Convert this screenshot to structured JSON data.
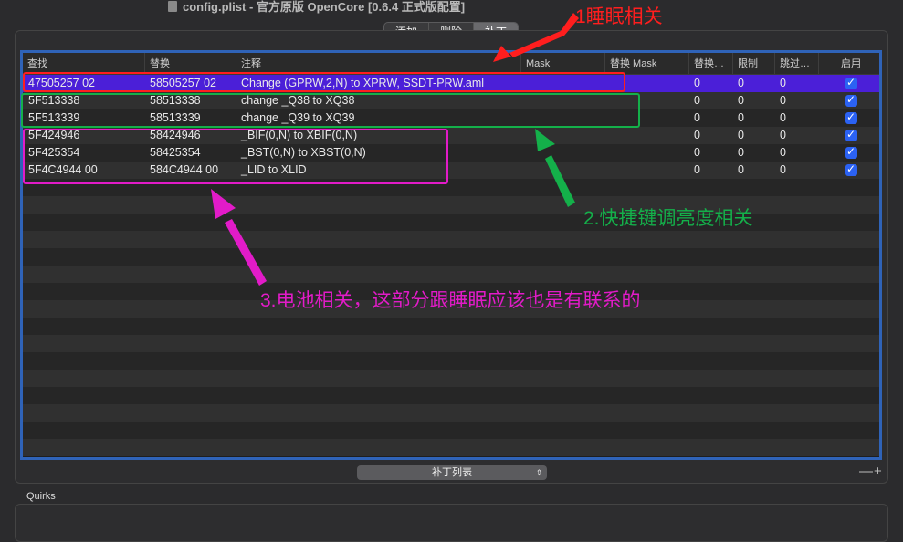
{
  "window": {
    "title": "config.plist - 官方原版 OpenCore [0.6.4 正式版配置]"
  },
  "segmented": {
    "tabs": [
      "添加",
      "删除",
      "补丁"
    ],
    "active": "补丁"
  },
  "table": {
    "headers": [
      "查找",
      "替换",
      "注释",
      "Mask",
      "替换 Mask",
      "替换…",
      "限制",
      "跳过…",
      "启用"
    ],
    "rows": [
      {
        "find": "47505257 02",
        "replace": "58505257 02",
        "comment": "Change (GPRW,2,N) to XPRW, SSDT-PRW.aml",
        "count": "0",
        "limit": "0",
        "skip": "0",
        "enabled": true,
        "selected": true
      },
      {
        "find": "5F513338",
        "replace": "58513338",
        "comment": "change _Q38 to XQ38",
        "count": "0",
        "limit": "0",
        "skip": "0",
        "enabled": true
      },
      {
        "find": "5F513339",
        "replace": "58513339",
        "comment": "change _Q39 to XQ39",
        "count": "0",
        "limit": "0",
        "skip": "0",
        "enabled": true
      },
      {
        "find": "5F424946",
        "replace": "58424946",
        "comment": "_BIF(0,N) to XBIF(0,N)",
        "count": "0",
        "limit": "0",
        "skip": "0",
        "enabled": true
      },
      {
        "find": "5F425354",
        "replace": "58425354",
        "comment": "_BST(0,N) to XBST(0,N)",
        "count": "0",
        "limit": "0",
        "skip": "0",
        "enabled": true
      },
      {
        "find": "5F4C4944 00",
        "replace": "584C4944 00",
        "comment": "_LID to XLID",
        "count": "0",
        "limit": "0",
        "skip": "0",
        "enabled": true
      }
    ]
  },
  "footer": {
    "popup_label": "补丁列表",
    "minus": "—",
    "plus": "+"
  },
  "quirks": {
    "label": "Quirks"
  },
  "annotations": {
    "sleep": {
      "text": "1睡眠相关",
      "color": "#ff1e1e"
    },
    "hotkey": {
      "text": "2.快捷键调亮度相关",
      "color": "#14b04a"
    },
    "battery": {
      "text": "3.电池相关，这部分跟睡眠应该也是有联系的",
      "color": "#e21bc8"
    }
  }
}
